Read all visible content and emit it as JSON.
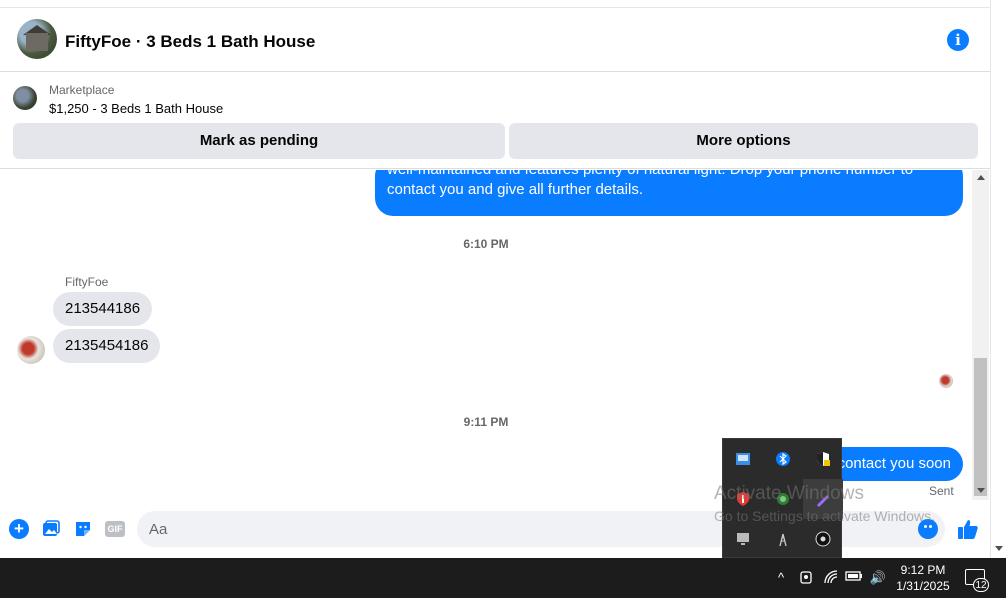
{
  "header": {
    "title": "FiftyFoe · 3 Beds 1 Bath House",
    "avatar_icon": "house-photo",
    "info_icon": "info-icon",
    "info_glyph": "i"
  },
  "listing": {
    "source": "Marketplace",
    "price_title": "$1,250 - 3 Beds 1 Bath House",
    "mark_pending_label": "Mark as pending",
    "more_options_label": "More options"
  },
  "thread": {
    "outgoing_partial": {
      "line1": "well-maintained and features plenty of natural light. Drop your phone number to",
      "line2": "contact you and give all further details."
    },
    "time1": "6:10 PM",
    "sender_name": "FiftyFoe",
    "incoming": [
      "213544186",
      "2135454186"
    ],
    "time2": "9:11 PM",
    "outgoing_last": "contact you soon",
    "status": "Sent"
  },
  "composer": {
    "placeholder": "Aa",
    "gif_label": "GIF",
    "plus_glyph": "+"
  },
  "tray_popup": {
    "icons": [
      "network-adapter-icon",
      "bluetooth-icon",
      "security-shield-icon",
      "antivirus-icon",
      "sync-icon",
      "pen-icon",
      "display-icon",
      "wifi-tower-icon",
      "media-icon"
    ]
  },
  "watermark": {
    "line1": "Activate Windows",
    "line2": "Go to Settings to activate Windows."
  },
  "taskbar": {
    "time": "9:12 PM",
    "date": "1/31/2025",
    "notification_count": "12",
    "up_glyph": "^",
    "volume_glyph": "🔊"
  },
  "colors": {
    "accent": "#0a7cff",
    "bubble_in": "#e4e6eb",
    "taskbar": "#1c1c1c"
  }
}
